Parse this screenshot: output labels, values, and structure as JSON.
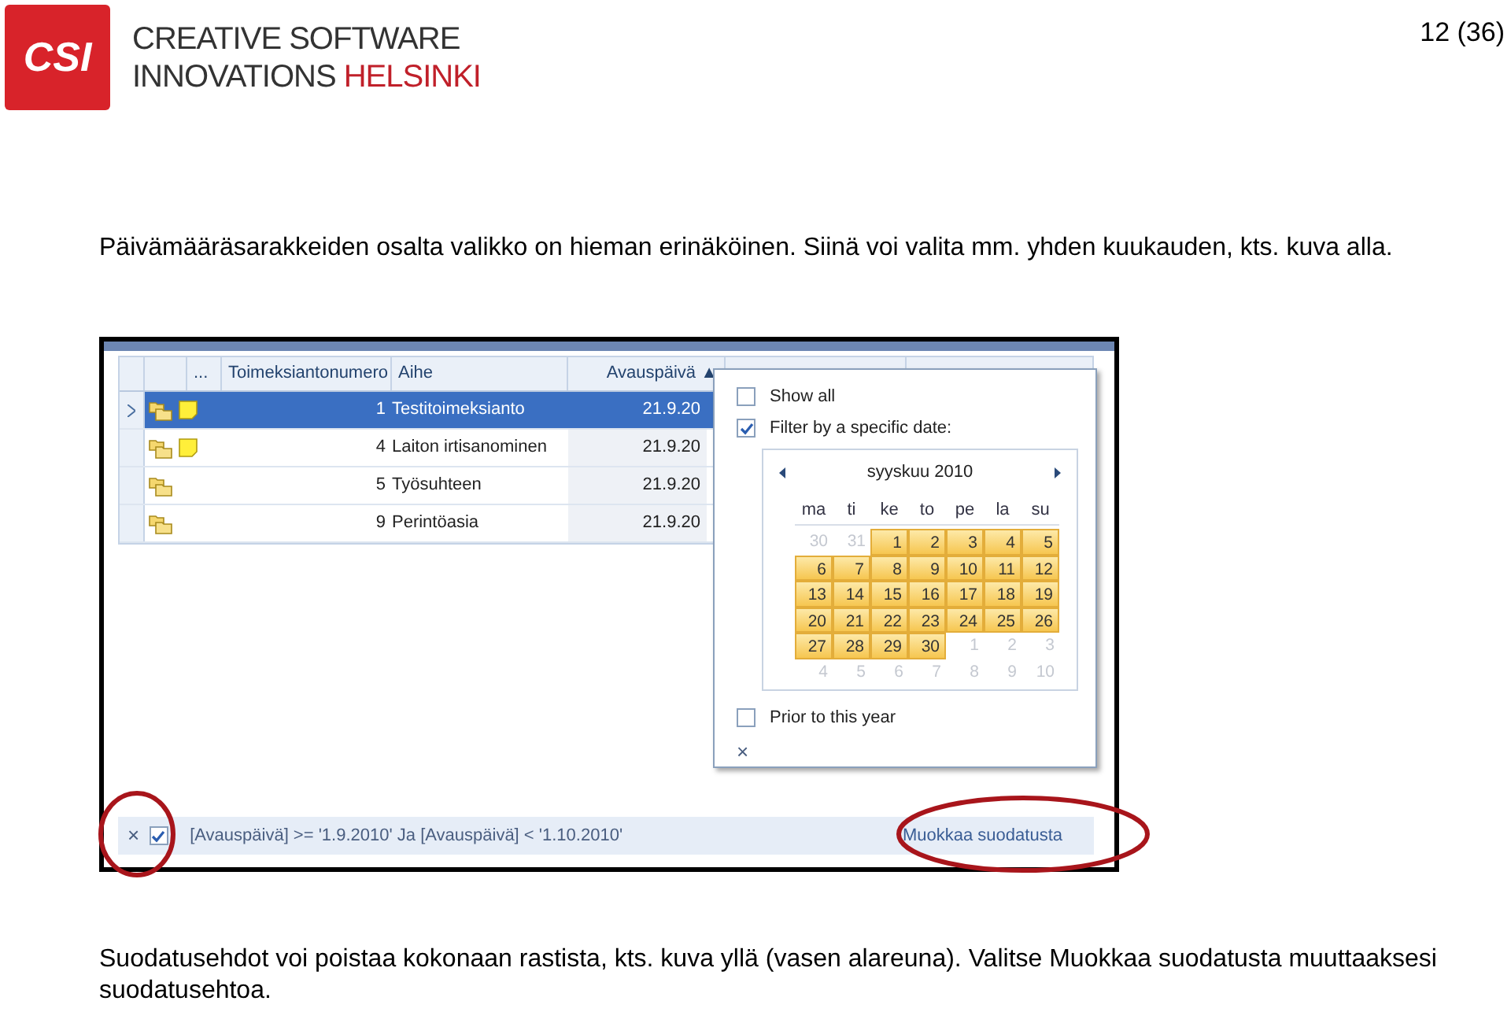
{
  "header": {
    "logo_text": "CSI",
    "company_line_1": "CREATIVE SOFTWARE",
    "company_line_2": "INNOVATIONS",
    "company_city": "HELSINKI",
    "page_number": "12 (36)"
  },
  "intro": "Päivämääräsarakkeiden osalta valikko on hieman erinäköinen. Siinä voi valita mm. yhden kuukauden, kts. kuva alla.",
  "screenshot": {
    "grid": {
      "columns": [
        "...",
        "Toimeksiantonumero",
        "Aihe",
        "Avauspäivä ▲"
      ],
      "rows": [
        {
          "selected": true,
          "note": true,
          "number": "1",
          "subject": "Testitoimeksianto",
          "date": "21.9.20"
        },
        {
          "selected": false,
          "note": true,
          "number": "4",
          "subject": "Laiton irtisanominen",
          "date": "21.9.20"
        },
        {
          "selected": false,
          "note": false,
          "number": "5",
          "subject": "Työsuhteen",
          "date": "21.9.20"
        },
        {
          "selected": false,
          "note": false,
          "number": "9",
          "subject": "Perintöasia",
          "date": "21.9.20"
        }
      ]
    },
    "filter_popup": {
      "options": [
        {
          "label": "Show all",
          "checked": false
        },
        {
          "label": "Filter by a specific date:",
          "checked": true
        }
      ],
      "calendar": {
        "month": "syyskuu 2010",
        "weekdays": [
          "ma",
          "ti",
          "ke",
          "to",
          "pe",
          "la",
          "su"
        ],
        "weeks": [
          [
            {
              "d": "30",
              "selected": false
            },
            {
              "d": "31",
              "selected": false
            },
            {
              "d": "1",
              "selected": true
            },
            {
              "d": "2",
              "selected": true
            },
            {
              "d": "3",
              "selected": true
            },
            {
              "d": "4",
              "selected": true
            },
            {
              "d": "5",
              "selected": true
            }
          ],
          [
            {
              "d": "6",
              "selected": true
            },
            {
              "d": "7",
              "selected": true
            },
            {
              "d": "8",
              "selected": true
            },
            {
              "d": "9",
              "selected": true
            },
            {
              "d": "10",
              "selected": true
            },
            {
              "d": "11",
              "selected": true
            },
            {
              "d": "12",
              "selected": true
            }
          ],
          [
            {
              "d": "13",
              "selected": true
            },
            {
              "d": "14",
              "selected": true
            },
            {
              "d": "15",
              "selected": true
            },
            {
              "d": "16",
              "selected": true
            },
            {
              "d": "17",
              "selected": true
            },
            {
              "d": "18",
              "selected": true
            },
            {
              "d": "19",
              "selected": true
            }
          ],
          [
            {
              "d": "20",
              "selected": true
            },
            {
              "d": "21",
              "selected": true
            },
            {
              "d": "22",
              "selected": true
            },
            {
              "d": "23",
              "selected": true
            },
            {
              "d": "24",
              "selected": true
            },
            {
              "d": "25",
              "selected": true
            },
            {
              "d": "26",
              "selected": true
            }
          ],
          [
            {
              "d": "27",
              "selected": true
            },
            {
              "d": "28",
              "selected": true
            },
            {
              "d": "29",
              "selected": true
            },
            {
              "d": "30",
              "selected": true
            },
            {
              "d": "1",
              "selected": false
            },
            {
              "d": "2",
              "selected": false
            },
            {
              "d": "3",
              "selected": false
            }
          ],
          [
            {
              "d": "4",
              "selected": false
            },
            {
              "d": "5",
              "selected": false
            },
            {
              "d": "6",
              "selected": false
            },
            {
              "d": "7",
              "selected": false
            },
            {
              "d": "8",
              "selected": false
            },
            {
              "d": "9",
              "selected": false
            },
            {
              "d": "10",
              "selected": false
            }
          ]
        ]
      },
      "prior_option": {
        "label": "Prior to this year",
        "checked": false
      },
      "close": "×"
    },
    "filter_bar": {
      "close": "×",
      "enabled": true,
      "expression": "[Avauspäivä] >= '1.9.2010' Ja [Avauspäivä] < '1.10.2010'",
      "edit_link": "Muokkaa suodatusta"
    }
  },
  "caption": "Suodatusehdot voi poistaa kokonaan rastista, kts. kuva yllä (vasen alareuna). Valitse Muokkaa suodatusta muuttaaksesi suodatusehtoa."
}
